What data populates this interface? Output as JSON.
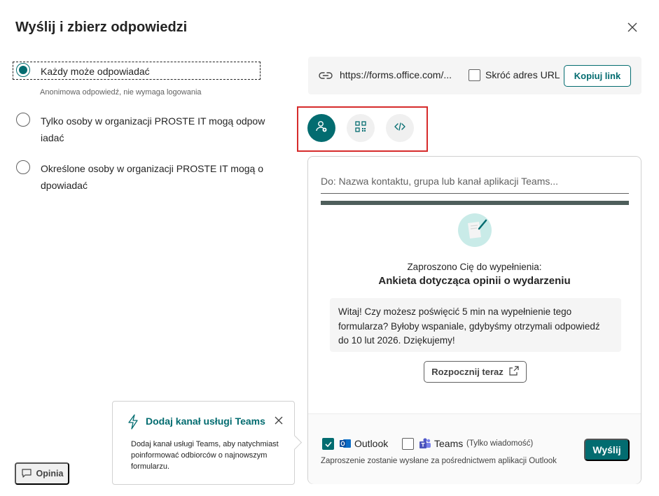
{
  "dialog": {
    "title": "Wyślij i zbierz odpowiedzi"
  },
  "audience": {
    "options": [
      {
        "label": "Każdy może odpowiadać",
        "description": "Anonimowa odpowiedź, nie wymaga logowania",
        "selected": true
      },
      {
        "label_line1": "Tylko osoby w organizacji PROSTE IT mogą odpow",
        "label_line2": "iadać",
        "selected": false
      },
      {
        "label_line1": "Określone osoby w organizacji PROSTE IT mogą o",
        "label_line2": "dpowiadać",
        "selected": false
      }
    ]
  },
  "link": {
    "url": "https://forms.office.com/...",
    "shorten_label": "Skróć adres URL",
    "copy_label": "Kopiuj link"
  },
  "methods": [
    {
      "icon": "invite-people-icon",
      "active": true
    },
    {
      "icon": "qr-code-icon",
      "active": false
    },
    {
      "icon": "embed-code-icon",
      "active": false
    }
  ],
  "invite": {
    "to_placeholder": "Do: Nazwa kontaktu, grupa lub kanał aplikacji Teams...",
    "invited_text": "Zaproszono Cię do wypełnienia:",
    "form_title": "Ankieta dotycząca opinii o wydarzeniu",
    "message": "Witaj! Czy możesz poświęcić 5 min na wypełnienie tego formularza? Byłoby wspaniale, gdybyśmy otrzymali odpowiedź do 10 lut 2026. Dziękujemy!",
    "start_label": "Rozpocznij teraz",
    "outlook_label": "Outlook",
    "outlook_checked": true,
    "teams_label": "Teams",
    "teams_note": "(Tylko wiadomość)",
    "teams_checked": false,
    "footer_note": "Zaproszenie zostanie wysłane za pośrednictwem aplikacji Outlook",
    "send_label": "Wyślij"
  },
  "callout": {
    "title": "Dodaj kanał usługi Teams",
    "body": "Dodaj kanał usługi Teams, aby natychmiast poinformować odbiorców o najnowszym formularzu."
  },
  "feedback": {
    "label": "Opinia"
  },
  "colors": {
    "accent": "#036c70",
    "highlight_box": "#d62b2b"
  }
}
